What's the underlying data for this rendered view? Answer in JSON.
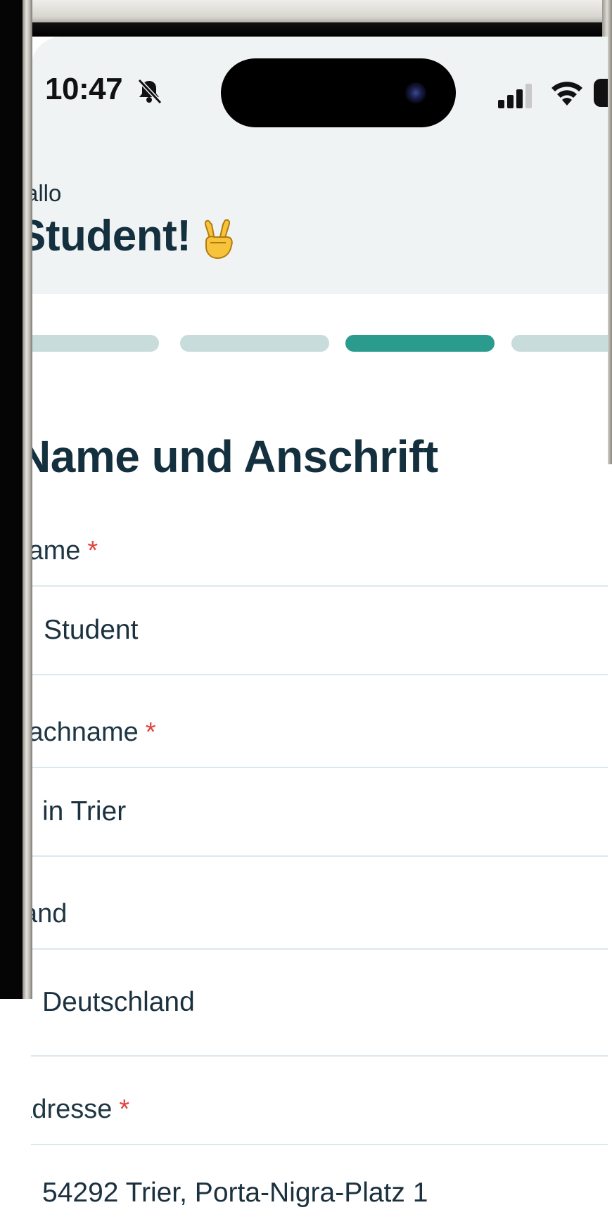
{
  "status_bar": {
    "time": "10:47"
  },
  "header": {
    "greeting": "allo",
    "name": "Student!",
    "emoji_icon": "victory-hand-icon"
  },
  "progress": {
    "total_visible": 4,
    "active_index": 2
  },
  "form": {
    "title": "Name und Anschrift",
    "fields": [
      {
        "label": "lame",
        "required": true,
        "value": "Student"
      },
      {
        "label": "lachname",
        "required": true,
        "value": "in Trier"
      },
      {
        "label": "and",
        "required": false,
        "value": "Deutschland",
        "type": "select"
      },
      {
        "label": "Adresse",
        "required": true,
        "value": "54292 Trier, Porta-Nigra-Platz 1"
      }
    ],
    "required_mark": "*"
  },
  "colors": {
    "accent": "#2a9b8c",
    "progress_inactive": "#c8dcdb",
    "required": "#e0453f",
    "text_dark": "#14303f",
    "header_bg": "#f0f3f4"
  }
}
